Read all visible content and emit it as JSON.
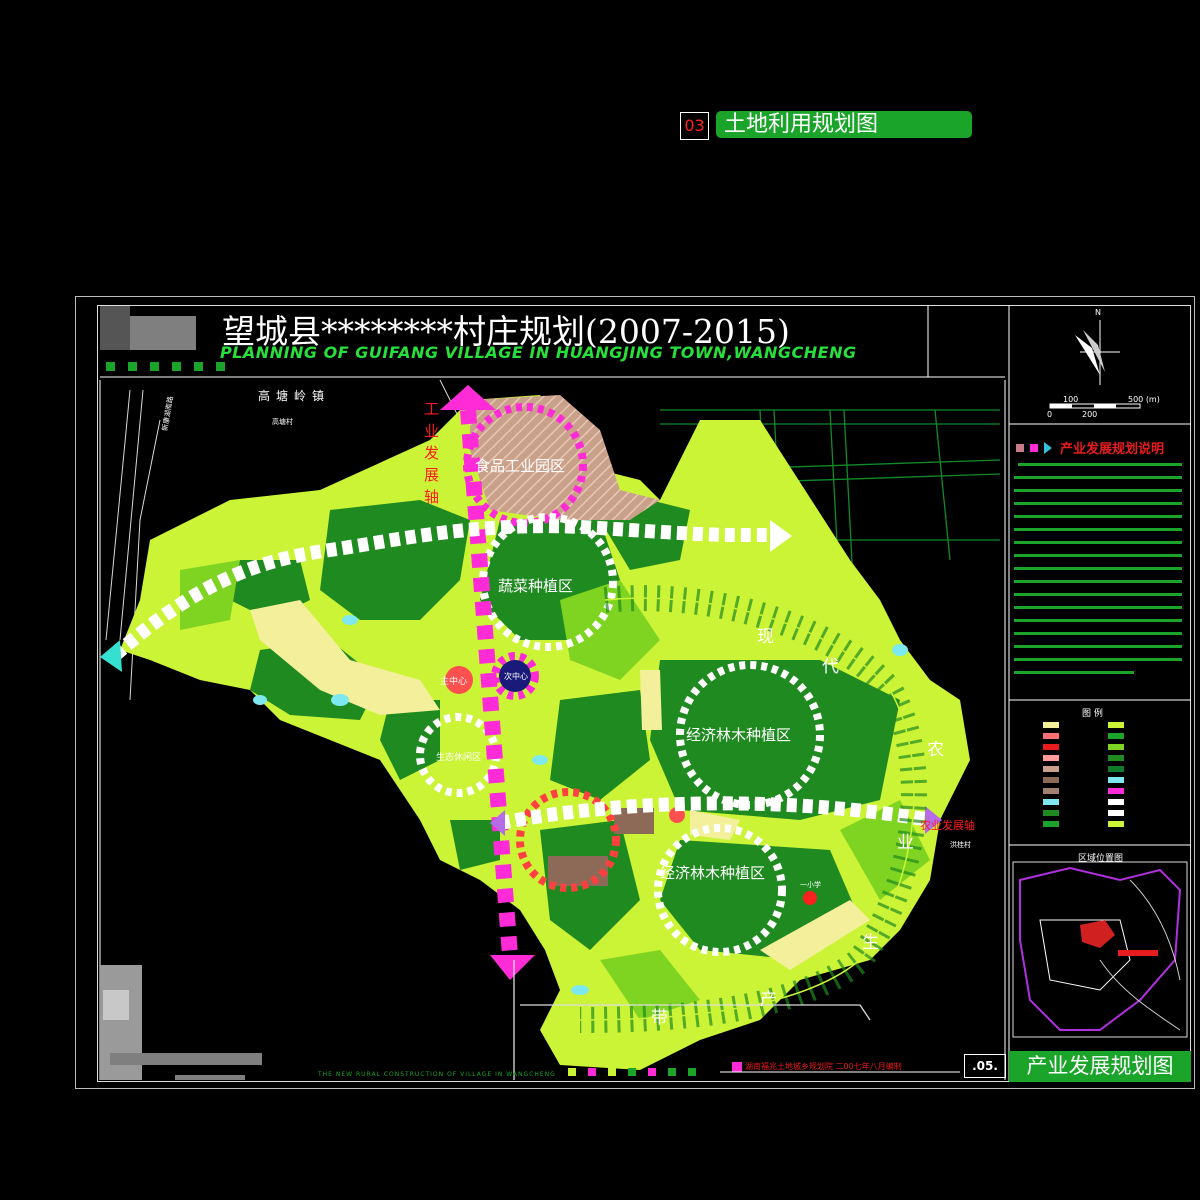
{
  "header": {
    "tag_number": "03",
    "tag_title": "土地利用规划图"
  },
  "sheet": {
    "title": "望城县********村庄规划(2007-2015)",
    "subtitle": "PLANNING OF GUIFANG VILLAGE IN HUANGJING TOWN,WANGCHENG",
    "sheet_number": ".05.",
    "bottom_title": "产业发展规划图",
    "bottom_left_caption": "THE NEW RURAL CONSTRUCTION OF VILLAGE IN WANGCHENG",
    "bottom_company": "湖南福兆土地城乡规划院 二00七年八月编制"
  },
  "map": {
    "labels": {
      "town_north": "高塘岭镇",
      "village_north": "高塘村",
      "road_north": "新康湖南路",
      "axis_vertical": "工业发展轴",
      "food_park": "食品工业园区",
      "vegetable_zone": "蔬菜种植区",
      "economic_forest_1": "经济林木种植区",
      "economic_forest_2": "经济林木种植区",
      "eco_leisure": "生态休闲区",
      "main_center": "主中心",
      "sub_center": "次中心",
      "belt_chars": [
        "现",
        "代",
        "农",
        "业",
        "生",
        "产",
        "带"
      ],
      "axis_agri": "农业发展轴",
      "town_east": "洪桂村",
      "school": "一小学"
    },
    "colors": {
      "light_green": "#ccf436",
      "mid_green": "#7fd321",
      "dark_green": "#1f8a1f",
      "pale_yellow": "#f3ef9a",
      "cyan": "#7de8f0",
      "brown_hatch": "#c9a08a",
      "magenta": "#ff2bd6",
      "white": "#ffffff",
      "road_green": "#0f7a2a"
    }
  },
  "sidebar": {
    "north_label": "N",
    "scale_labels": [
      "0",
      "100",
      "200",
      "500 (m)"
    ],
    "explain_title": "产业发展规划说明",
    "legend_title": "图    例",
    "location_title": "区域位置图"
  }
}
